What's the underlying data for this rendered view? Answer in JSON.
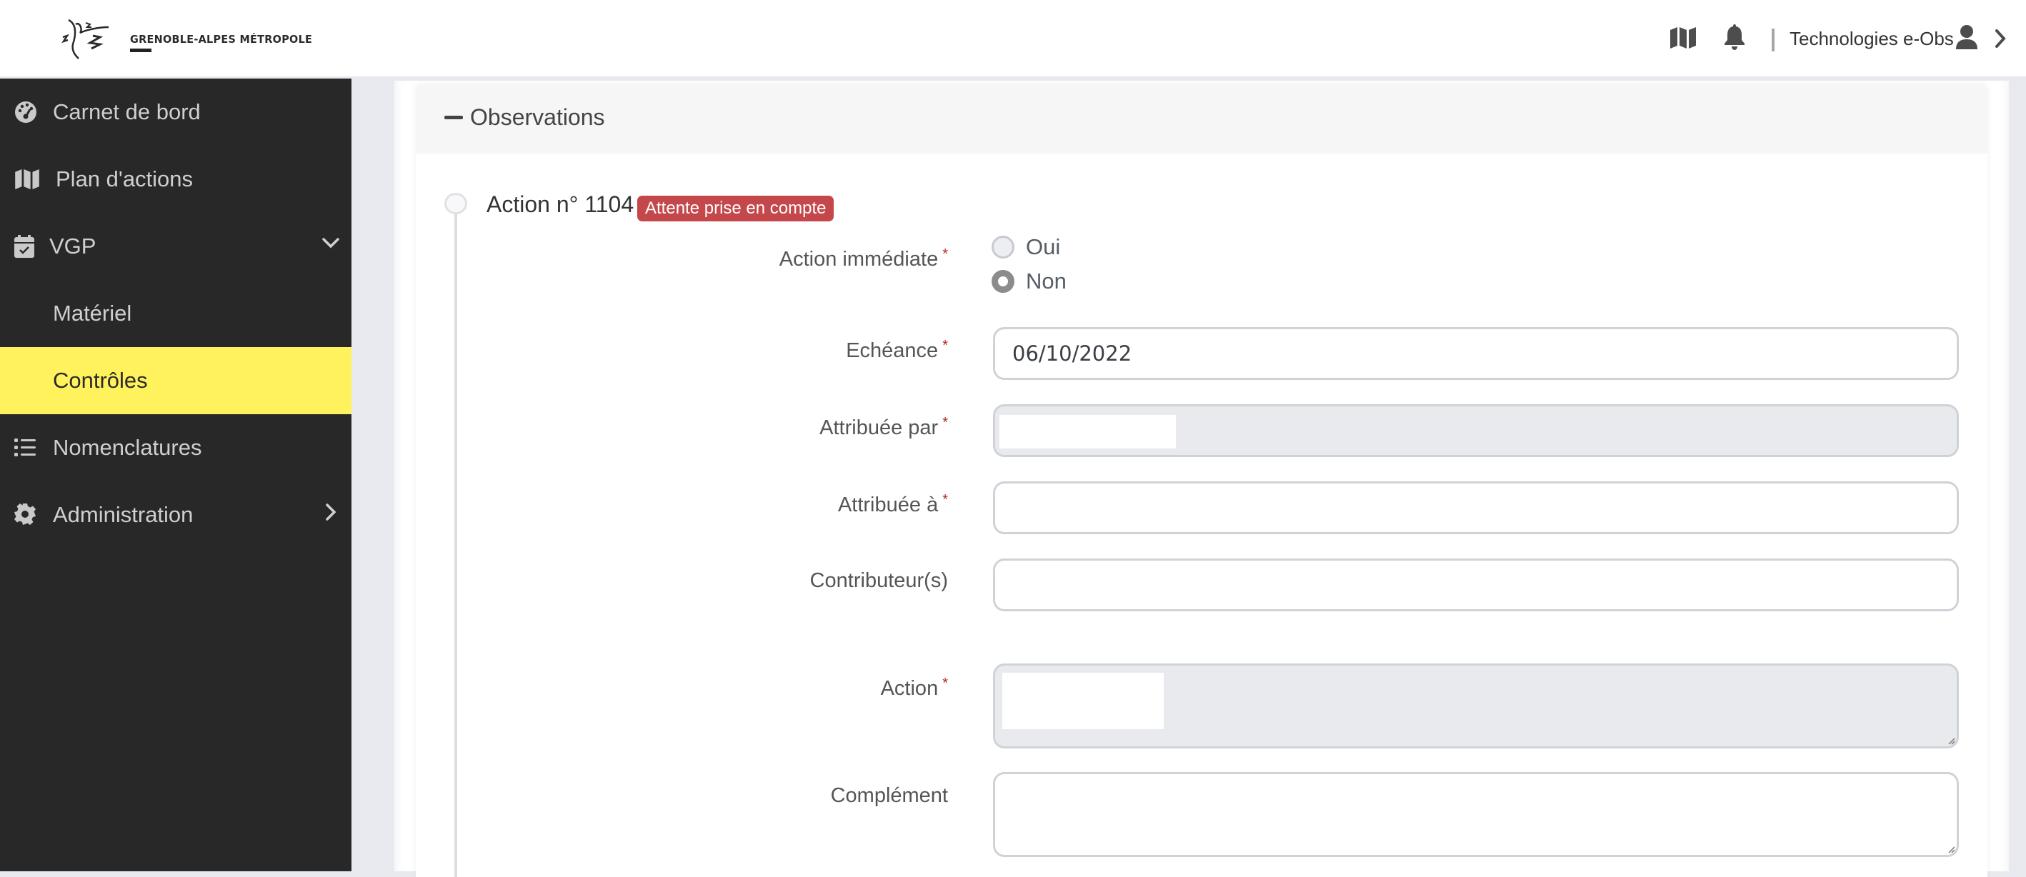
{
  "header": {
    "logo_text": "GRENOBLE-ALPES MÉTROPOLE",
    "user_name": "Technologies e-Obs",
    "icons": [
      "map-icon",
      "bell-icon",
      "user-icon",
      "chevron-right-icon"
    ]
  },
  "sidebar": {
    "items": [
      {
        "label": "Carnet de bord",
        "icon": "dashboard-icon"
      },
      {
        "label": "Plan d'actions",
        "icon": "map-icon"
      },
      {
        "label": "VGP",
        "icon": "calendar-check-icon",
        "expanded": true
      },
      {
        "label": "Matériel",
        "sub": true
      },
      {
        "label": "Contrôles",
        "sub": true,
        "active": true
      },
      {
        "label": "Nomenclatures",
        "icon": "list-icon"
      },
      {
        "label": "Administration",
        "icon": "gear-icon",
        "expanded": false
      }
    ],
    "active_color": "#fff25c"
  },
  "section": {
    "title": "Observations",
    "collapse_symbol": "−"
  },
  "action": {
    "title": "Action n° 1104",
    "status_badge": "Attente prise en compte",
    "status_color": "#c4474b",
    "fields": {
      "immediate": {
        "label": "Action immédiate",
        "required": "*",
        "options": [
          "Oui",
          "Non"
        ],
        "selected": "Non"
      },
      "echeance": {
        "label": "Echéance",
        "required": "*",
        "value": "06/10/2022"
      },
      "attribuee_par": {
        "label": "Attribuée par",
        "required": "*",
        "value": ""
      },
      "attribuee_a": {
        "label": "Attribuée à",
        "required": "*",
        "value": ""
      },
      "contributeurs": {
        "label": "Contributeur(s)",
        "value": ""
      },
      "action": {
        "label": "Action",
        "required": "*",
        "value": ""
      },
      "complement": {
        "label": "Complément",
        "value": ""
      }
    }
  }
}
